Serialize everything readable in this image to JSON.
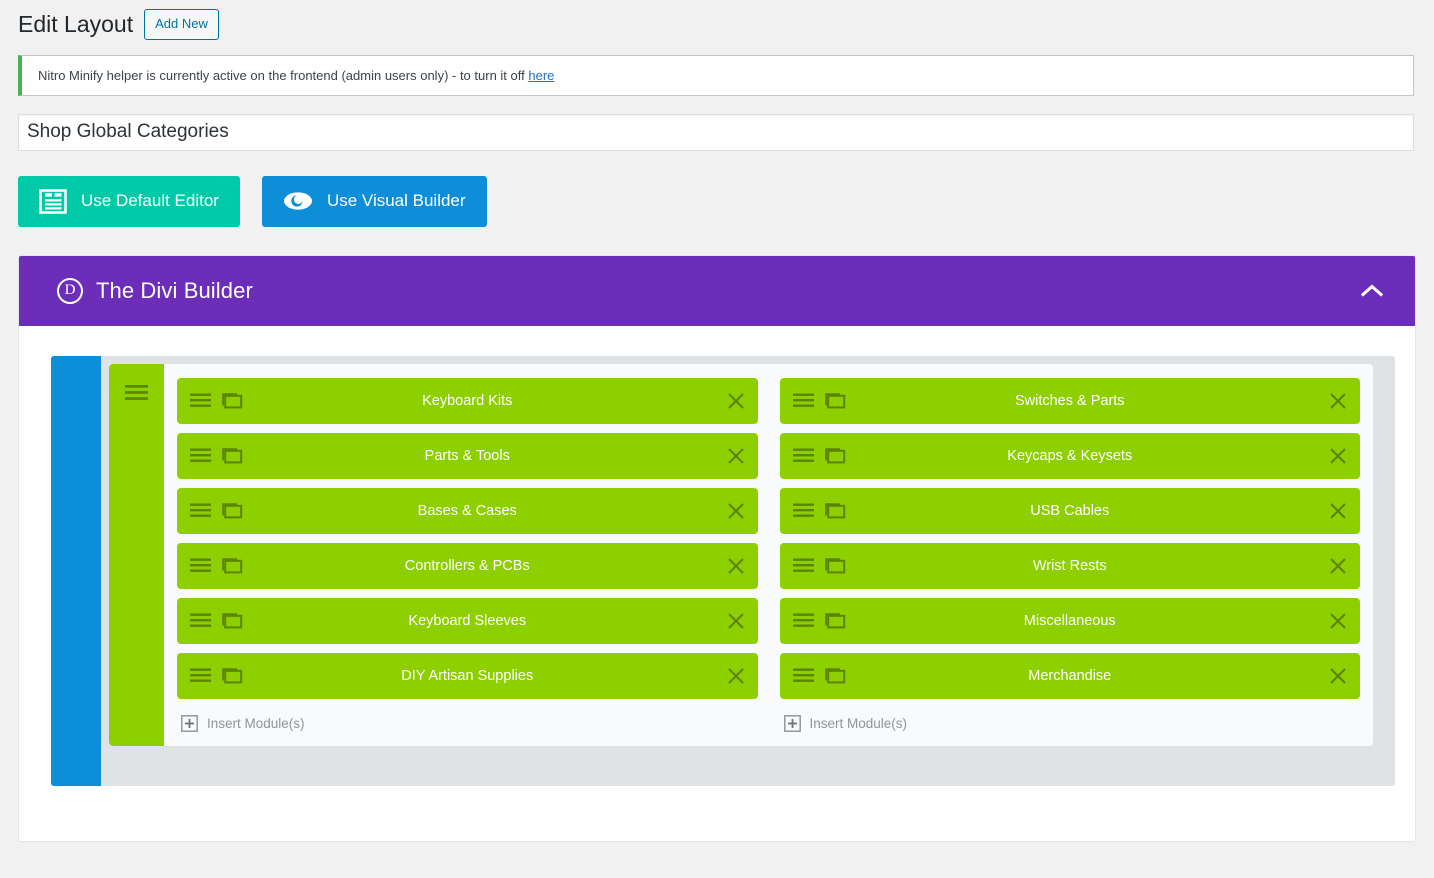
{
  "header": {
    "title": "Edit Layout",
    "add_new_label": "Add New"
  },
  "notice": {
    "text": "Nitro Minify helper is currently active on the frontend (admin users only) - to turn it off ",
    "link_label": "here",
    "accent_color": "#46b450"
  },
  "title_field": {
    "value": "Shop Global Categories",
    "placeholder": "Enter title here"
  },
  "mode_buttons": [
    {
      "label": "Use Default Editor",
      "icon": "layout-editor-icon",
      "color": "#00c9a7"
    },
    {
      "label": "Use Visual Builder",
      "icon": "eye-icon",
      "color": "#0e8ed8"
    }
  ],
  "divi_builder": {
    "title": "The Divi Builder",
    "logo_letter": "D",
    "header_color": "#6c2eb9",
    "toggle_icon": "chevron-up-icon",
    "section": {
      "handle_color": "#0c8ed9",
      "row": {
        "handle_icon": "drag-handle-icon",
        "module_color": "#8ecf00",
        "insert_label": "Insert Module(s)",
        "columns": [
          {
            "modules": [
              {
                "label": "Keyboard Kits"
              },
              {
                "label": "Parts & Tools"
              },
              {
                "label": "Bases & Cases"
              },
              {
                "label": "Controllers & PCBs"
              },
              {
                "label": "Keyboard Sleeves"
              },
              {
                "label": "DIY Artisan Supplies"
              }
            ]
          },
          {
            "modules": [
              {
                "label": "Switches & Parts"
              },
              {
                "label": "Keycaps & Keysets"
              },
              {
                "label": "USB Cables"
              },
              {
                "label": "Wrist Rests"
              },
              {
                "label": "Miscellaneous"
              },
              {
                "label": "Merchandise"
              }
            ]
          }
        ]
      }
    }
  }
}
